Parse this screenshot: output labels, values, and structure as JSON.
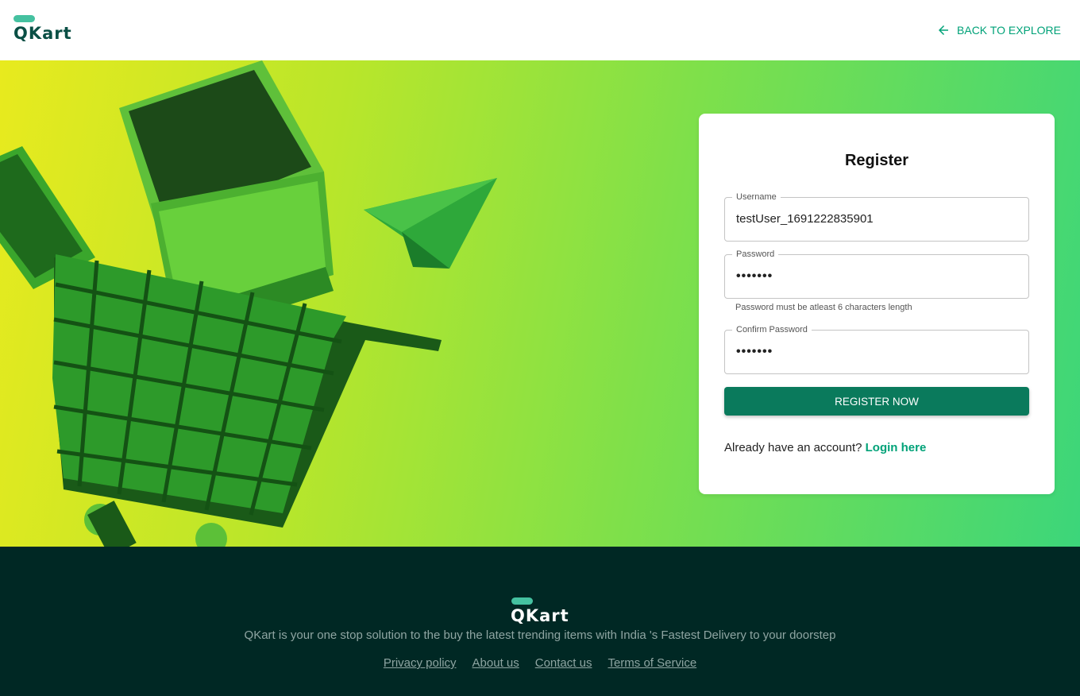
{
  "header": {
    "logo_text": "QKart",
    "back_button_label": "BACK TO EXPLORE",
    "icons": {
      "back": "arrow-left-icon"
    }
  },
  "register": {
    "title": "Register",
    "username": {
      "label": "Username",
      "value": "testUser_1691222835901"
    },
    "password": {
      "label": "Password",
      "value": "•••••••",
      "helper": "Password must be atleast 6 characters length"
    },
    "confirm_password": {
      "label": "Confirm Password",
      "value": "•••••••"
    },
    "submit_label": "REGISTER NOW",
    "login_prompt": "Already have an account?",
    "login_link": "Login here"
  },
  "footer": {
    "logo_text": "QKart",
    "description": "QKart is your one stop solution to the buy the latest trending items with India 's Fastest Delivery to your doorstep",
    "links": [
      "Privacy policy",
      "About us",
      "Contact us",
      "Terms of Service"
    ]
  },
  "colors": {
    "accent": "#00a278",
    "button": "#0a7a5c",
    "footer_bg": "#002824",
    "logo_pill": "#45c1a0"
  }
}
